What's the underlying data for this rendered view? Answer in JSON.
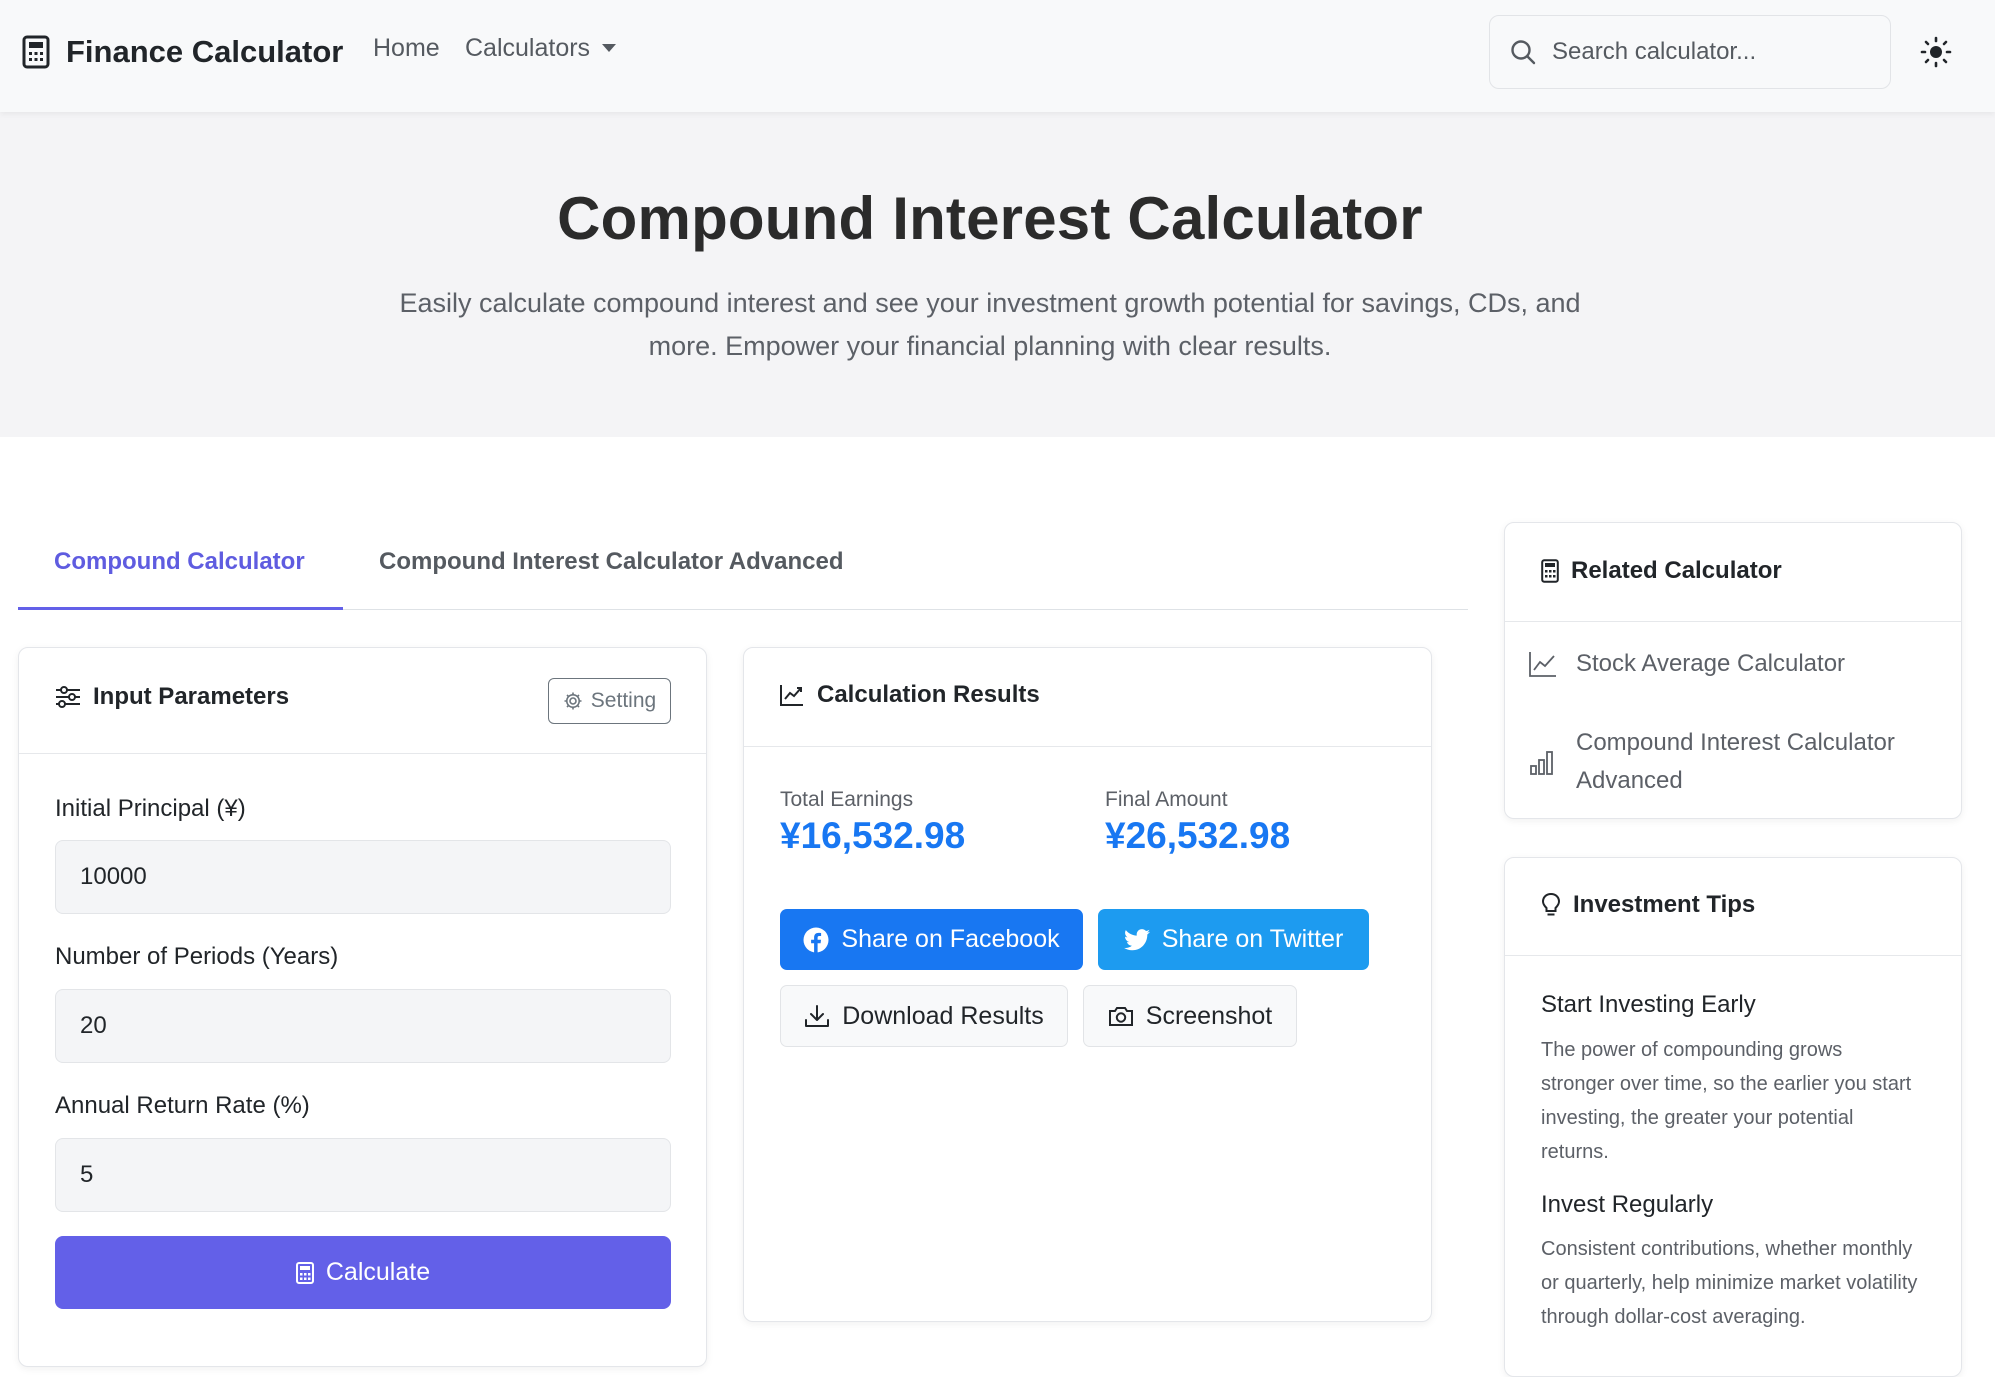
{
  "navbar": {
    "brand": "Finance Calculator",
    "links": {
      "home": "Home",
      "calculators": "Calculators"
    },
    "search_placeholder": "Search calculator..."
  },
  "hero": {
    "title": "Compound Interest Calculator",
    "subtitle": "Easily calculate compound interest and see your investment growth potential for savings, CDs, and more. Empower your financial planning with clear results."
  },
  "tabs": [
    {
      "label": "Compound Calculator",
      "active": true
    },
    {
      "label": "Compound Interest Calculator Advanced",
      "active": false
    }
  ],
  "inputs": {
    "title": "Input Parameters",
    "setting_label": "Setting",
    "fields": [
      {
        "label": "Initial Principal (¥)",
        "value": "10000"
      },
      {
        "label": "Number of Periods (Years)",
        "value": "20"
      },
      {
        "label": "Annual Return Rate (%)",
        "value": "5"
      }
    ],
    "calculate_label": "Calculate"
  },
  "results": {
    "title": "Calculation Results",
    "total_earnings_label": "Total Earnings",
    "total_earnings_value": "¥16,532.98",
    "final_amount_label": "Final Amount",
    "final_amount_value": "¥26,532.98",
    "share_facebook": "Share on Facebook",
    "share_twitter": "Share on Twitter",
    "download": "Download Results",
    "screenshot": "Screenshot"
  },
  "related": {
    "title": "Related Calculator",
    "items": [
      {
        "label": "Stock Average Calculator"
      },
      {
        "label": "Compound Interest Calculator Advanced"
      }
    ]
  },
  "tips": {
    "title": "Investment Tips",
    "items": [
      {
        "title": "Start Investing Early",
        "text": "The power of compounding grows stronger over time, so the earlier you start investing, the greater your potential returns."
      },
      {
        "title": "Invest Regularly",
        "text": "Consistent contributions, whether monthly or quarterly, help minimize market volatility through dollar-cost averaging."
      }
    ]
  },
  "colors": {
    "accent": "#6360e8",
    "result_blue": "#1877f2",
    "facebook": "#1877f2",
    "twitter": "#1d9bf0"
  }
}
